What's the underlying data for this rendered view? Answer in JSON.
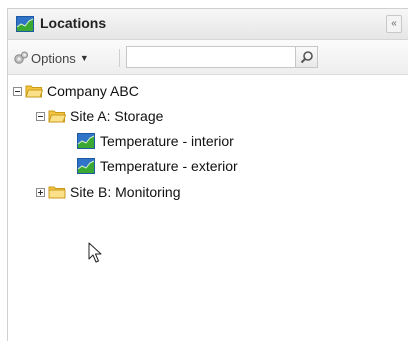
{
  "panel": {
    "title": "Locations",
    "collapse_glyph": "«",
    "title_icon": "chart-icon"
  },
  "toolbar": {
    "options_label": "Options",
    "options_icon": "gear-icon",
    "search_value": "",
    "search_placeholder": ""
  },
  "tree": {
    "root": {
      "label": "Company ABC",
      "expanded": true
    },
    "site_a": {
      "label": "Site A: Storage",
      "expanded": true
    },
    "sensor_interior": {
      "label": "Temperature - interior"
    },
    "sensor_exterior": {
      "label": "Temperature - exterior"
    },
    "site_b": {
      "label": "Site B: Monitoring",
      "expanded": false
    }
  },
  "colors": {
    "folder": "#f5c542",
    "chart_green": "#3aa832",
    "chart_blue": "#2f74c9"
  }
}
